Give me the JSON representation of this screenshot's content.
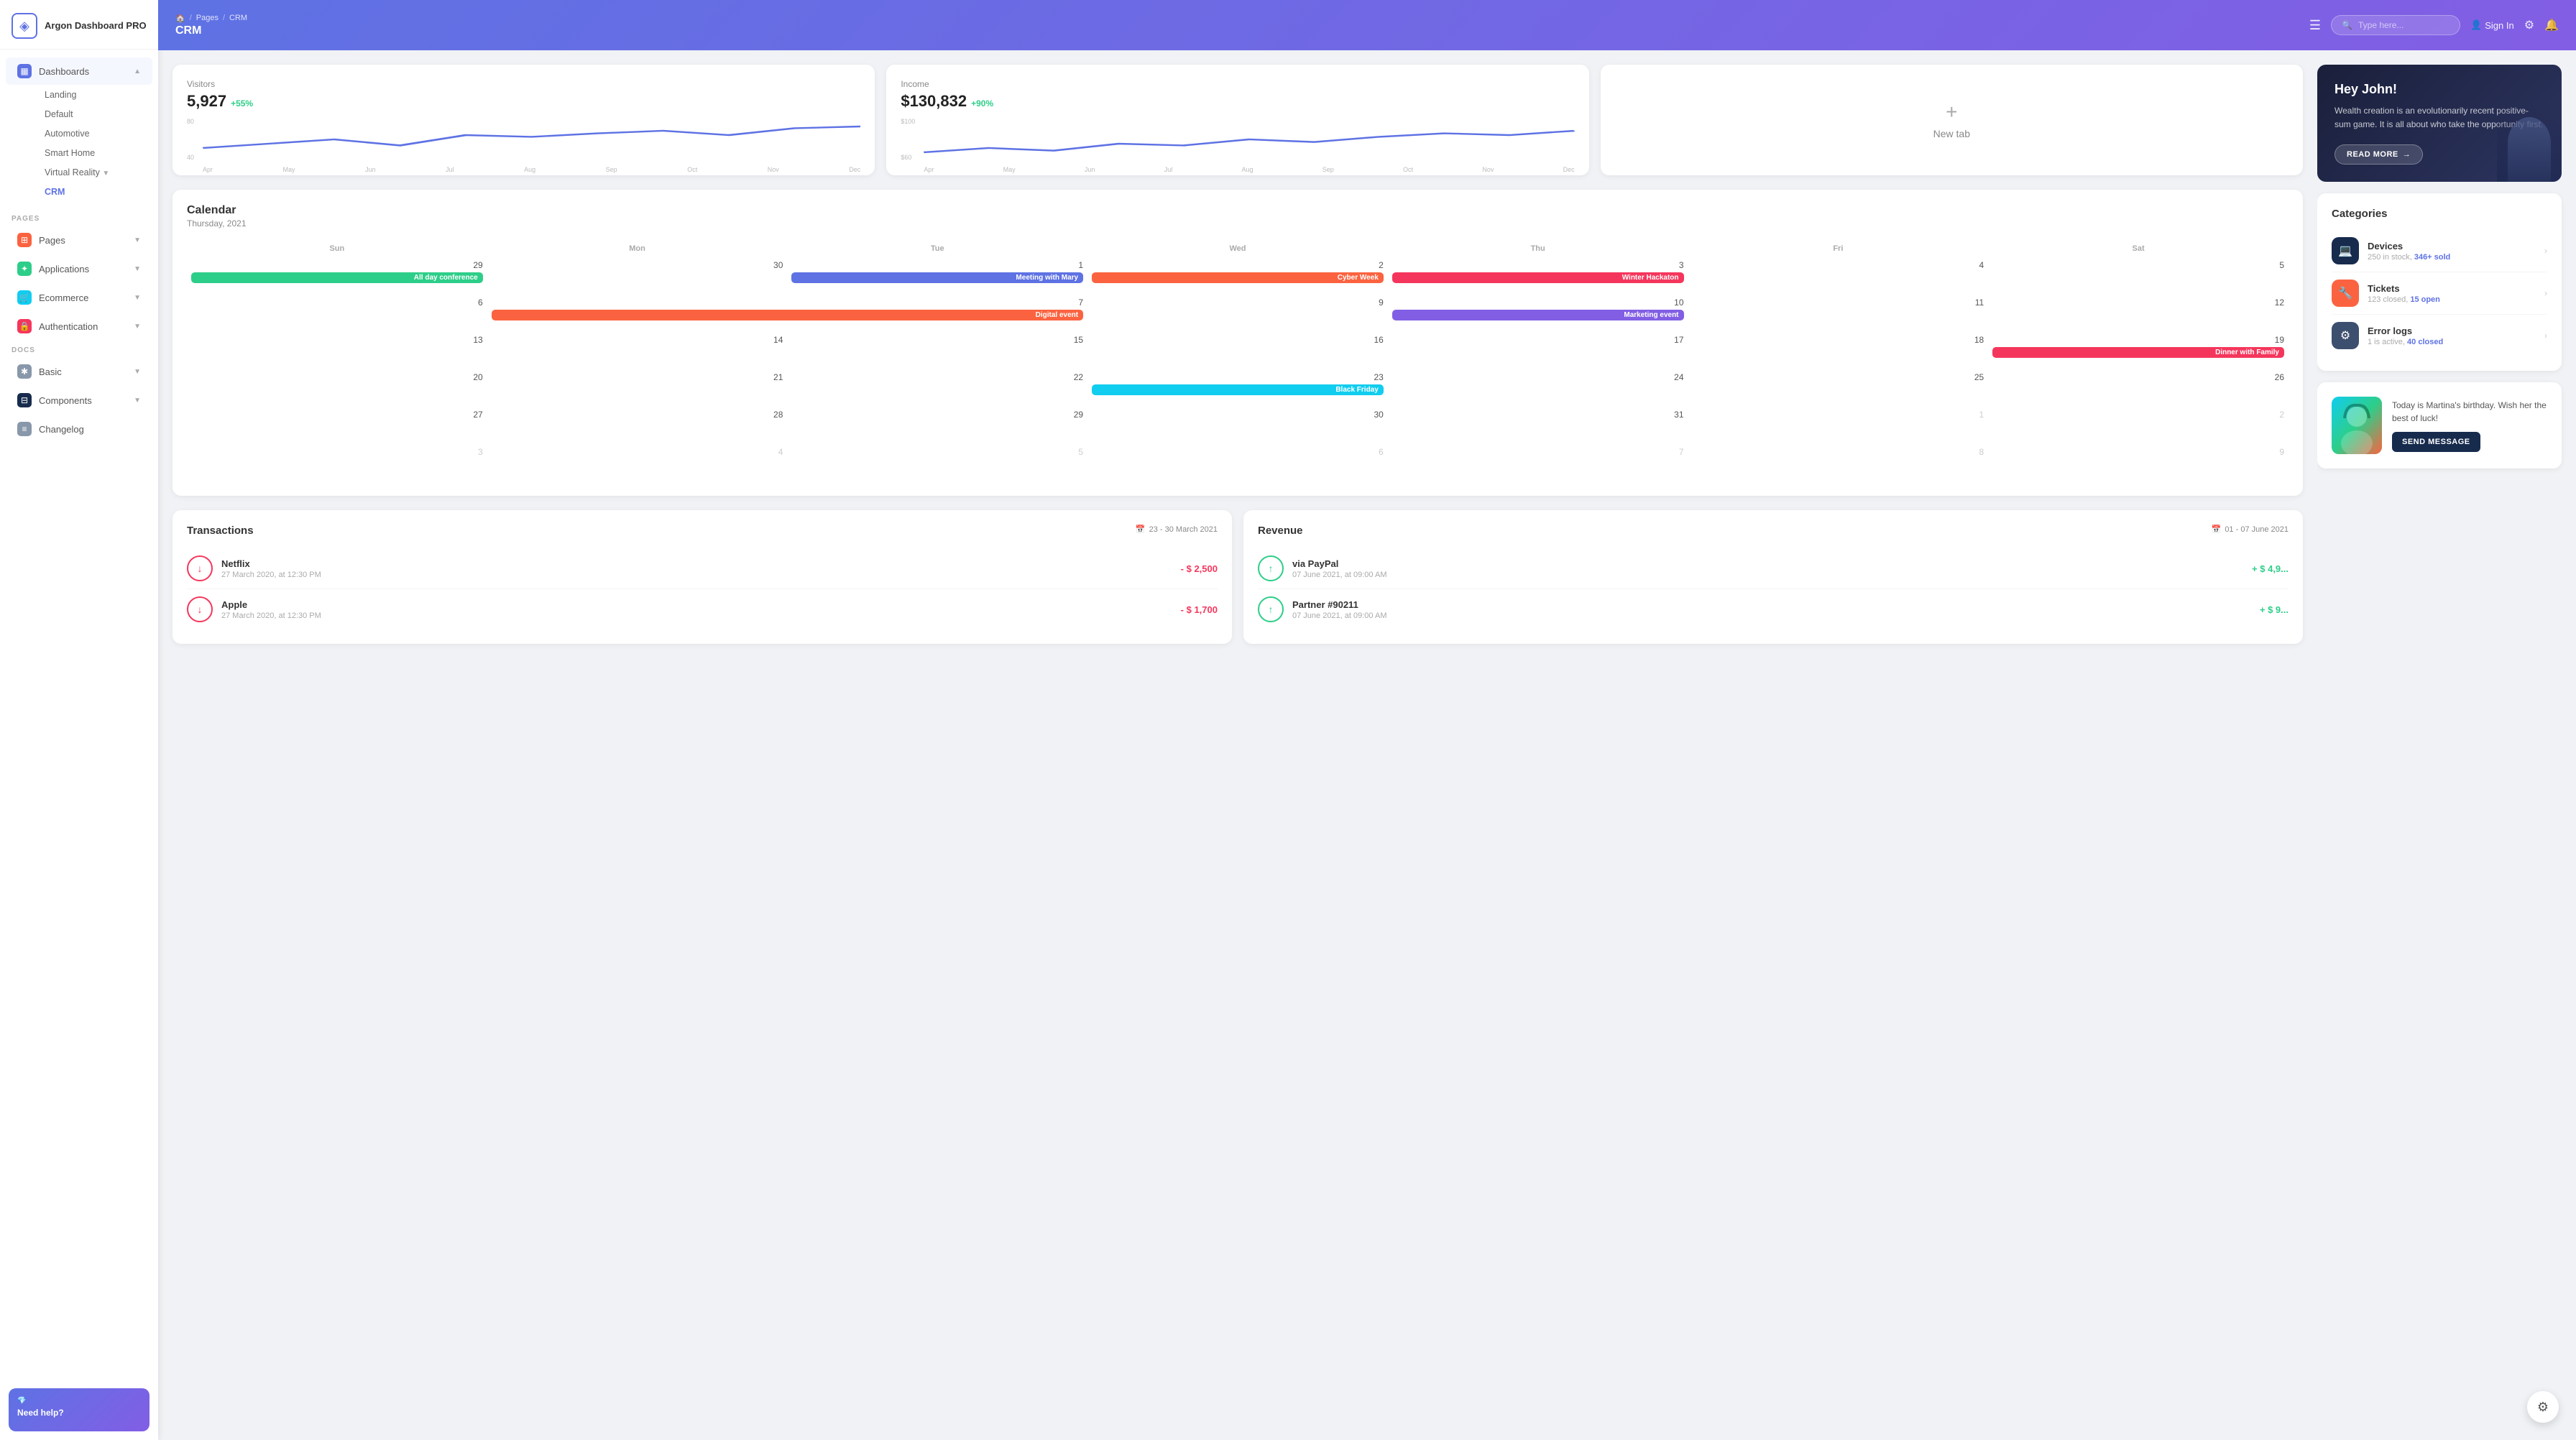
{
  "app": {
    "title": "Argon Dashboard PRO",
    "logo_icon": "◈"
  },
  "sidebar": {
    "dashboards_label": "Dashboards",
    "sub_items": [
      {
        "label": "Landing",
        "active": false
      },
      {
        "label": "Default",
        "active": false
      },
      {
        "label": "Automotive",
        "active": false
      },
      {
        "label": "Smart Home",
        "active": false
      },
      {
        "label": "Virtual Reality",
        "active": false
      },
      {
        "label": "CRM",
        "active": true
      }
    ],
    "pages_section": "PAGES",
    "docs_section": "DOCS",
    "pages_label": "Pages",
    "applications_label": "Applications",
    "ecommerce_label": "Ecommerce",
    "authentication_label": "Authentication",
    "basic_label": "Basic",
    "components_label": "Components",
    "changelog_label": "Changelog",
    "need_help": "Need help?"
  },
  "topbar": {
    "breadcrumb_home": "🏠",
    "breadcrumb_pages": "Pages",
    "breadcrumb_crm": "CRM",
    "title": "CRM",
    "search_placeholder": "Type here...",
    "sign_in": "Sign In",
    "hamburger": "☰"
  },
  "stats": {
    "visitors_label": "Visitors",
    "visitors_value": "5,927",
    "visitors_change": "+55%",
    "income_label": "Income",
    "income_value": "$130,832",
    "income_change": "+90%",
    "new_tab_label": "New tab",
    "chart_months": [
      "Apr",
      "May",
      "Jun",
      "Jul",
      "Aug",
      "Sep",
      "Oct",
      "Nov",
      "Dec"
    ],
    "visitors_y": [
      "80",
      "40"
    ],
    "income_y": [
      "$100",
      "$60"
    ]
  },
  "calendar": {
    "title": "Calendar",
    "subtitle": "Thursday, 2021",
    "days": [
      "Sun",
      "Mon",
      "Tue",
      "Wed",
      "Thu",
      "Fri",
      "Sat"
    ],
    "events": [
      {
        "week": 0,
        "day": 0,
        "label": "All day conference",
        "color": "green",
        "span": 1,
        "cell": "0-0"
      },
      {
        "week": 0,
        "day": 2,
        "label": "Meeting with Mary",
        "color": "blue",
        "cell": "0-2"
      },
      {
        "week": 0,
        "day": 3,
        "label": "Cyber Week",
        "color": "orange",
        "cell": "0-3"
      },
      {
        "week": 0,
        "day": 4,
        "label": "Winter Hackaton",
        "color": "red",
        "cell": "0-4"
      },
      {
        "week": 1,
        "day": 1,
        "label": "Digital event",
        "color": "orange",
        "span": 2,
        "cell": "1-1"
      },
      {
        "week": 1,
        "day": 4,
        "label": "Marketing event",
        "color": "purple",
        "cell": "1-4"
      },
      {
        "week": 2,
        "day": 5,
        "label": "Dinner with Family",
        "color": "red",
        "cell": "2-5"
      },
      {
        "week": 3,
        "day": 3,
        "label": "Black Friday",
        "color": "cyan",
        "cell": "3-3"
      }
    ]
  },
  "transactions": {
    "title": "Transactions",
    "date_range": "23 - 30 March 2021",
    "items": [
      {
        "name": "Netflix",
        "date": "27 March 2020, at 12:30 PM",
        "amount": "- $ 2,500",
        "type": "negative"
      },
      {
        "name": "Apple",
        "date": "27 March 2020, at 12:30 PM",
        "amount": "- $ 1,700",
        "type": "negative"
      }
    ]
  },
  "revenue": {
    "title": "Revenue",
    "date_range": "01 - 07 June 2021",
    "items": [
      {
        "name": "via PayPal",
        "date": "07 June 2021, at 09:00 AM",
        "amount": "+ $ 4,9...",
        "type": "positive"
      },
      {
        "name": "Partner #90211",
        "date": "07 June 2021, at 09:00 AM",
        "amount": "+ $ 9...",
        "type": "positive"
      }
    ]
  },
  "hero": {
    "greeting": "Hey John!",
    "text": "Wealth creation is an evolutionarily recent positive-sum game. It is all about who take the opportunity first.",
    "cta": "READ MORE"
  },
  "categories": {
    "title": "Categories",
    "items": [
      {
        "name": "Devices",
        "sub": "250 in stock, ",
        "sub_highlight": "346+ sold",
        "icon": "💻",
        "style": "dark"
      },
      {
        "name": "Tickets",
        "sub": "123 closed, ",
        "sub_highlight": "15 open",
        "icon": "🔧",
        "style": "orange"
      },
      {
        "name": "Error logs",
        "sub": "1 is active, ",
        "sub_highlight": "40 closed",
        "icon": "⚙",
        "style": "darkgray"
      }
    ]
  },
  "birthday": {
    "text": "Today is Martina's birthday. Wish her the best of luck!",
    "cta": "SEND MESSAGE"
  }
}
